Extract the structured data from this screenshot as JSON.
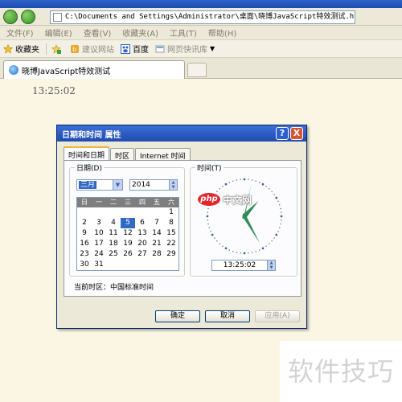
{
  "browser": {
    "address_url": "C:\\Documents and Settings\\Administrator\\桌面\\晓博JavaScript特效测试.html",
    "menu": [
      "文件(F)",
      "编辑(E)",
      "查看(V)",
      "收藏夹(A)",
      "工具(T)",
      "帮助(H)"
    ],
    "favorites_bar": {
      "favorites_label": "收藏夹",
      "suggested_sites": "建议网站",
      "baidu": "百度",
      "web_slice": "网页快讯库"
    },
    "tab_title": "晓博JavaScript特效测试"
  },
  "page": {
    "clock_text": "13:25:02"
  },
  "dialog": {
    "title": "日期和时间 属性",
    "help_glyph": "?",
    "close_glyph": "X",
    "tabs": [
      "时间和日期",
      "时区",
      "Internet 时间"
    ],
    "date_group_label": "日期(D)",
    "time_group_label": "时间(T)",
    "month_value": "三月",
    "year_value": "2014",
    "weekday_headers": [
      "日",
      "一",
      "二",
      "三",
      "四",
      "五",
      "六"
    ],
    "calendar_days": [
      "",
      "",
      "",
      "",
      "",
      "",
      "1",
      "2",
      "3",
      "4",
      "5",
      "6",
      "7",
      "8",
      "9",
      "10",
      "11",
      "12",
      "13",
      "14",
      "15",
      "16",
      "17",
      "18",
      "19",
      "20",
      "21",
      "22",
      "23",
      "24",
      "25",
      "26",
      "27",
      "28",
      "29",
      "30",
      "31"
    ],
    "selected_day": "5",
    "time_value": "13:25:02",
    "timezone_line": "当前时区：中国标准时间",
    "buttons": {
      "ok": "确定",
      "cancel": "取消",
      "apply": "应用(A)"
    }
  },
  "watermarks": {
    "php_logo": "php",
    "php_cn": "中文网",
    "tips": "软件技巧"
  },
  "colors": {
    "page_background": "#fbf6e4",
    "dialog_title_blue": "#1f4cae",
    "selection_blue": "#316ac5",
    "clock_hands": "#2e8b57"
  }
}
